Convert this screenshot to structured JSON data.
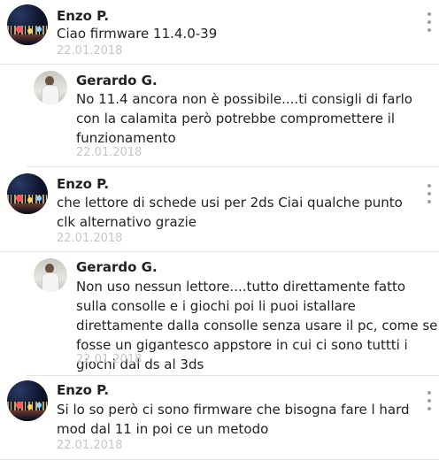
{
  "comments": [
    {
      "author": "Enzo P.",
      "text": "Ciao firmware 11.4.0-39",
      "date": "22.01.2018",
      "avatar_icon": "night-city-avatar-icon"
    },
    {
      "author": "Gerardo G.",
      "text": "No 11.4 ancora non è possibile....ti consigli di farlo con la calamita però potrebbe compromettere il funzionamento",
      "date": "22.01.2018",
      "avatar_icon": "person-avatar-icon"
    },
    {
      "author": "Enzo P.",
      "text": "che lettore di schede usi per 2ds Ciai qualche punto clk alternativo grazie",
      "date": "22.01.2018",
      "avatar_icon": "night-city-avatar-icon"
    },
    {
      "author": "Gerardo G.",
      "text": "Non uso nessun lettore....tutto direttamente fatto sulla consolle e i giochi poi li puoi istallare direttamente dalla consolle senza usare il pc, come se fosse un gigantesco appstore in cui ci sono tuttti i giochi dal ds al 3ds",
      "date": "22.01.2018",
      "avatar_icon": "person-avatar-icon"
    },
    {
      "author": "Enzo P.",
      "text": "Si lo so però ci sono firmware che bisogna fare l hard mod dal 11 in poi ce un metodo",
      "date": "22.01.2018",
      "avatar_icon": "night-city-avatar-icon"
    }
  ],
  "menu_icon": "more-vertical-icon",
  "colors": {
    "author": "#222222",
    "text": "#222222",
    "date": "#c6c6c6",
    "divider": "#e3e3e3",
    "menu_dots": "#9e9e9e"
  }
}
